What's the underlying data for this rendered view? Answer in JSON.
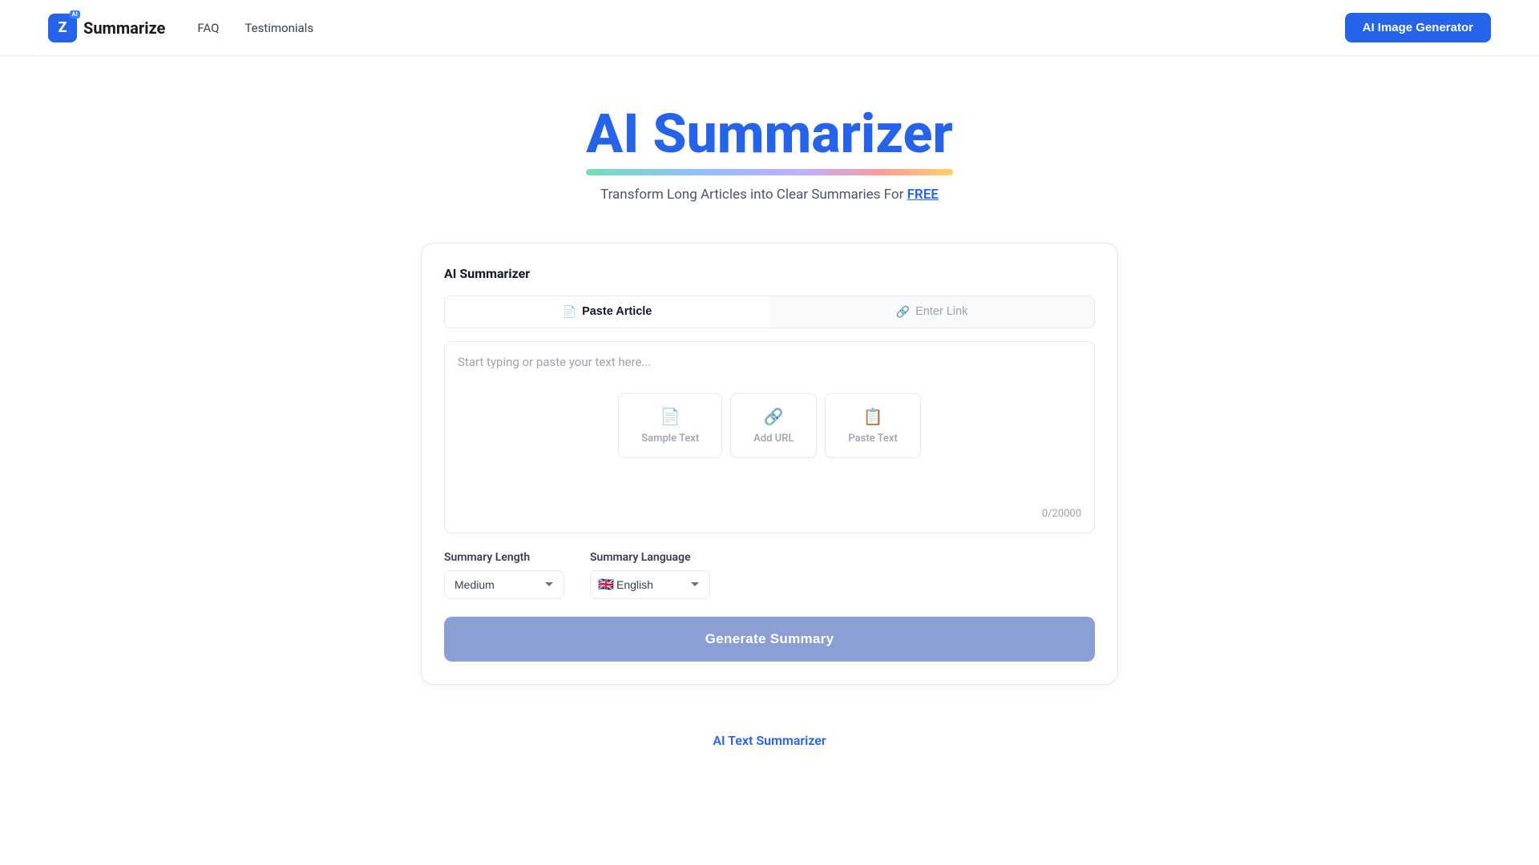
{
  "navbar": {
    "logo_letter": "Z",
    "logo_badge": "AI",
    "logo_text": "Summarize",
    "nav_faq": "FAQ",
    "nav_testimonials": "Testimonials",
    "btn_ai_generator": "AI Image Generator"
  },
  "hero": {
    "title": "AI Summarizer",
    "subtitle_text": "Transform Long Articles into Clear Summaries For ",
    "subtitle_free": "FREE"
  },
  "card": {
    "title": "AI Summarizer",
    "tab_paste": "Paste Article",
    "tab_link": "Enter Link",
    "textarea_placeholder": "Start typing or paste your text here...",
    "action_sample_text": "Sample Text",
    "action_add_url": "Add URL",
    "action_paste_text": "Paste Text",
    "char_count": "0/20000",
    "label_summary_length": "Summary Length",
    "label_summary_language": "Summary Language",
    "select_length_option": "Medium",
    "select_language_option": "English",
    "btn_generate": "Generate Summary"
  },
  "bottom": {
    "link_text": "AI Text Summarizer"
  },
  "colors": {
    "brand_blue": "#2563eb",
    "button_generate": "#8b9fd4"
  }
}
